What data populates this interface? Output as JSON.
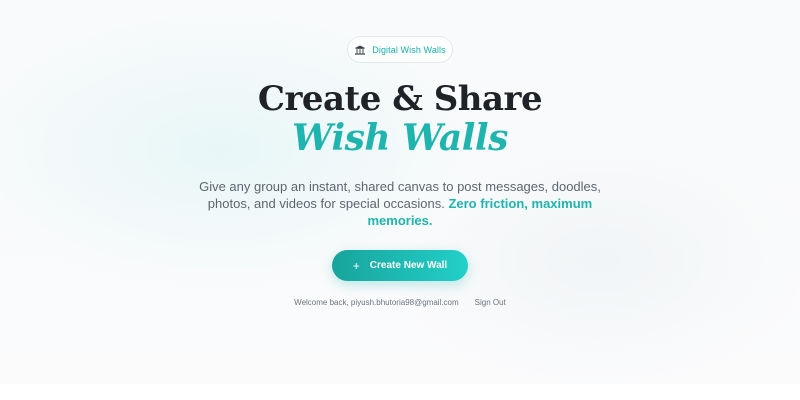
{
  "badge": {
    "icon": "temple-building-icon",
    "label": "Digital Wish Walls"
  },
  "hero": {
    "title_line1": "Create & Share",
    "title_line2": "Wish Walls",
    "subtitle": "Give any group an instant, shared canvas to post messages, doodles, photos, and videos for special occasions.",
    "subtitle_highlight": "Zero friction, maximum memories."
  },
  "cta": {
    "icon": "plus-icon",
    "label": "Create New Wall"
  },
  "user": {
    "welcome": "Welcome back, piyush.bhutoria98@gmail.com",
    "signout": "Sign Out"
  },
  "colors": {
    "accent": "#1fb4ad",
    "heading": "#1f2328",
    "body": "#5d6670"
  }
}
